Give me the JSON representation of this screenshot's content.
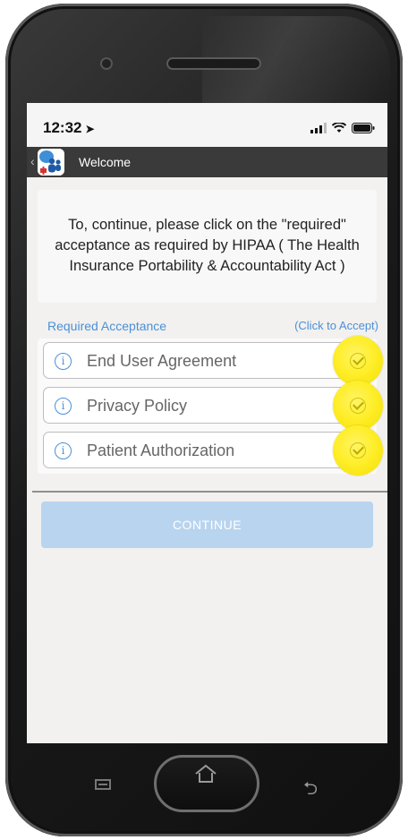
{
  "status": {
    "time": "12:32",
    "location_icon": "location-arrow-icon",
    "signal_icon": "signal-icon",
    "wifi_icon": "wifi-icon",
    "battery_icon": "battery-icon"
  },
  "nav": {
    "back_icon": "back-chevron-icon",
    "app_icon": "app-logo-icon",
    "title": "Welcome"
  },
  "message": {
    "text": "To, continue, please click on the \"required\" acceptance as required by HIPAA ( The Health Insurance Portability & Accountability Act )"
  },
  "acceptance": {
    "header": "Required Acceptance",
    "hint": "(Click to Accept)",
    "items": [
      {
        "label": "End User Agreement"
      },
      {
        "label": "Privacy Policy"
      },
      {
        "label": "Patient Authorization"
      }
    ]
  },
  "continue_button": {
    "label": "CONTINUE"
  },
  "colors": {
    "accent_blue": "#4a90d9",
    "continue_bg": "#b9d4ef",
    "highlight_yellow": "#ffee2a",
    "navbar_bg": "#3a3a3a"
  }
}
